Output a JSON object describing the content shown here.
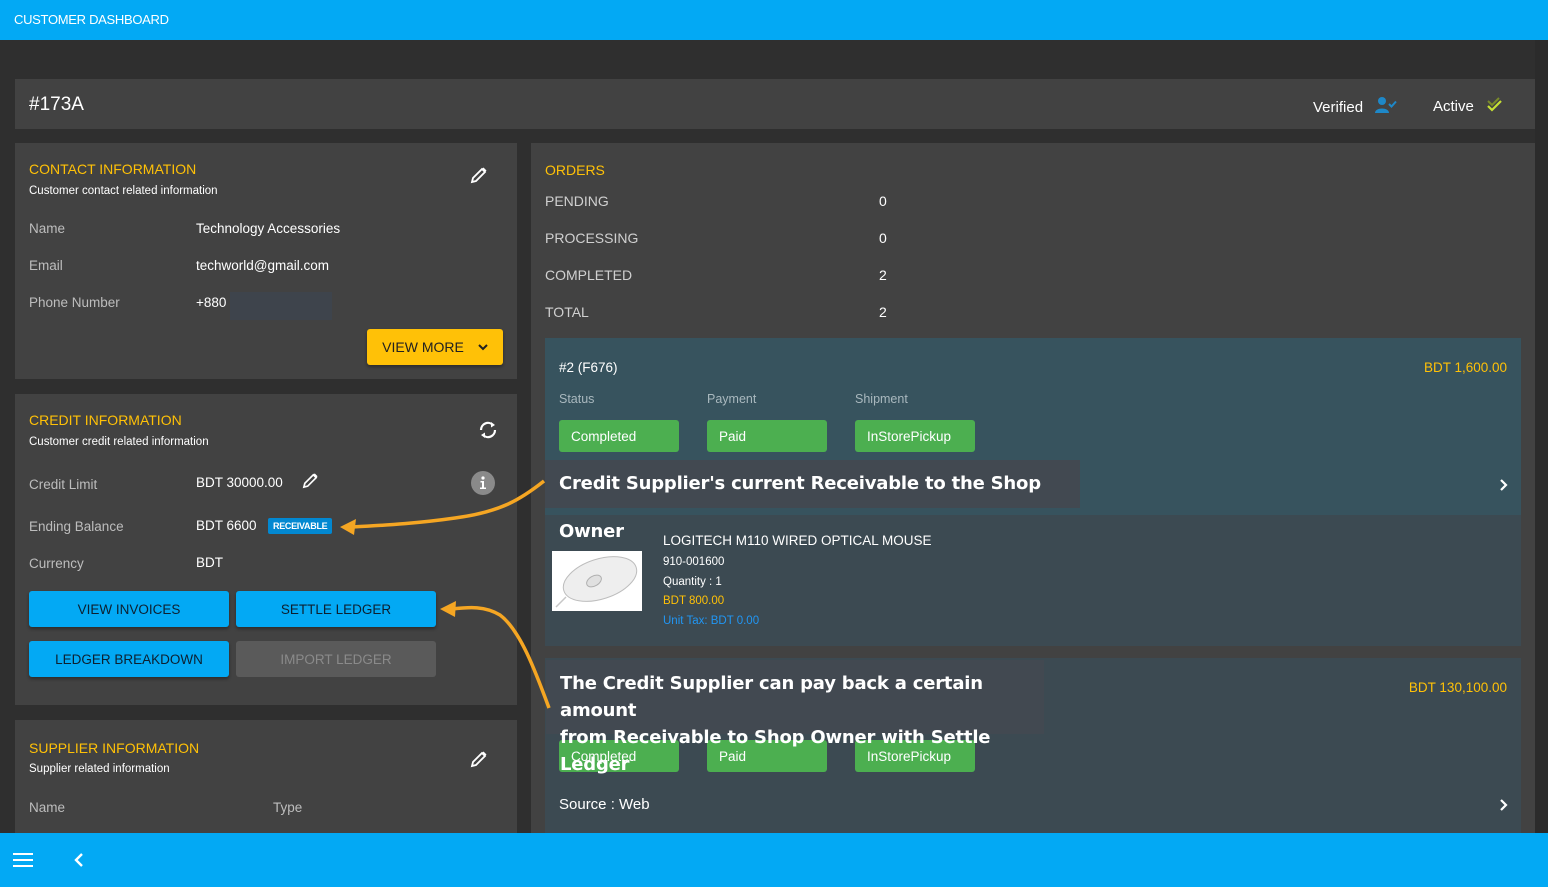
{
  "app": {
    "title": "CUSTOMER DASHBOARD"
  },
  "header": {
    "customer_id": "#173A",
    "verified_label": "Verified",
    "active_label": "Active",
    "icons": {
      "verified": "user-check-icon",
      "active": "double-check-icon"
    }
  },
  "contact": {
    "title": "CONTACT INFORMATION",
    "subtitle": "Customer contact related information",
    "rows": [
      {
        "label": "Name",
        "value": "Technology Accessories"
      },
      {
        "label": "Email",
        "value": "techworld@gmail.com"
      },
      {
        "label": "Phone Number",
        "value": "+880"
      }
    ],
    "view_more_label": "VIEW MORE"
  },
  "credit": {
    "title": "CREDIT INFORMATION",
    "subtitle": "Customer credit related information",
    "rows": [
      {
        "label": "Credit Limit",
        "value": "BDT 30000.00"
      },
      {
        "label": "Ending Balance",
        "value": "BDT 6600",
        "badge": "RECEIVABLE"
      },
      {
        "label": "Currency",
        "value": "BDT"
      }
    ],
    "buttons": {
      "view_invoices": "VIEW INVOICES",
      "settle_ledger": "SETTLE LEDGER",
      "ledger_breakdown": "LEDGER BREAKDOWN",
      "import_ledger": "IMPORT LEDGER"
    }
  },
  "supplier": {
    "title": "SUPPLIER INFORMATION",
    "subtitle": "Supplier related information",
    "columns": [
      "Name",
      "Type"
    ]
  },
  "orders": {
    "title": "ORDERS",
    "stats": [
      {
        "label": "PENDING",
        "value": "0"
      },
      {
        "label": "PROCESSING",
        "value": "0"
      },
      {
        "label": "COMPLETED",
        "value": "2"
      },
      {
        "label": "TOTAL",
        "value": "2"
      }
    ],
    "list": [
      {
        "id": "#2 (F676)",
        "total": "BDT 1,600.00",
        "status_label": "Status",
        "payment_label": "Payment",
        "shipment_label": "Shipment",
        "status": "Completed",
        "payment": "Paid",
        "shipment": "InStorePickup",
        "items": [
          {
            "name": "LOGITECH M110 WIRED OPTICAL MOUSE",
            "sku": "910-001600",
            "quantity": "Quantity : 1",
            "price": "BDT 800.00",
            "unit_tax": "Unit Tax: BDT 0.00"
          }
        ]
      },
      {
        "total": "BDT 130,100.00",
        "status": "Completed",
        "payment": "Paid",
        "shipment": "InStorePickup",
        "source": "Source : Web"
      }
    ]
  },
  "annotations": {
    "receivable_note": "Credit Supplier's current Receivable to the Shop Owner",
    "settle_note_line1": "The Credit Supplier can pay back a certain amount",
    "settle_note_line2": "from Receivable to Shop Owner with Settle Ledger"
  },
  "colors": {
    "primary": "#03a9f4",
    "accent": "#ffc107",
    "success": "#4caf50",
    "badge": "#0288d1",
    "annotation_arrow": "#f5a623"
  }
}
